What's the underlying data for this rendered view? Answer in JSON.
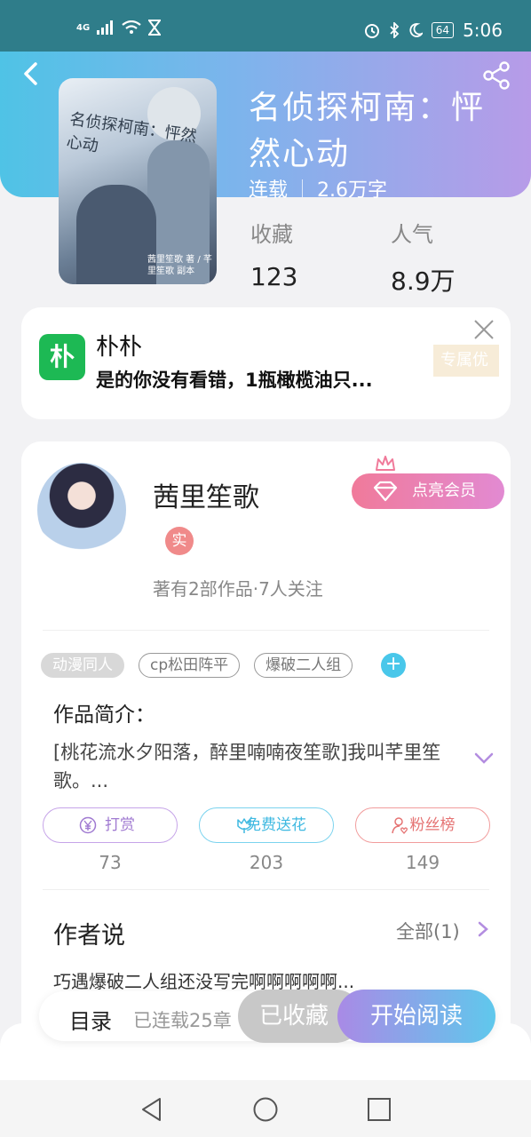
{
  "status_bar": {
    "network": "4G",
    "battery": "64",
    "time": "5:06"
  },
  "book": {
    "title": "名侦探柯南：怦然心动",
    "status": "连载",
    "word_count": "2.6万字",
    "cover_text": "名侦探柯南：怦然心动",
    "cover_credit": "茜里笙歌 著 / 芊里笙歌 副本",
    "stats": [
      {
        "label": "收藏",
        "value": "123"
      },
      {
        "label": "人气",
        "value": "8.9万"
      }
    ]
  },
  "ad": {
    "logo": "朴",
    "title": "朴朴",
    "desc": "是的你没有看错，1瓶橄榄油只...",
    "tag": "专属优"
  },
  "author": {
    "name": "茜里笙歌",
    "badge": "实",
    "vip_button": "点亮会员",
    "stats": "著有2部作品·7人关注",
    "tags": [
      "动漫同人",
      "cp松田阵平",
      "爆破二人组"
    ],
    "tag_add": "+",
    "intro_title": "作品简介：",
    "intro_text": "[桃花流水夕阳落，醉里喃喃夜笙歌]我叫芊里笙歌。...",
    "actions": [
      {
        "label": "打赏",
        "count": "73"
      },
      {
        "label": "免费送花",
        "count": "203"
      },
      {
        "label": "粉丝榜",
        "count": "149"
      }
    ],
    "says_title": "作者说",
    "says_all": "全部(1)",
    "says_text": "巧遇爆破二人组还没写完啊啊啊啊啊..."
  },
  "bottom_bar": {
    "toc": "目录",
    "serial": "已连载25章",
    "collected": "已收藏",
    "read": "开始阅读"
  }
}
